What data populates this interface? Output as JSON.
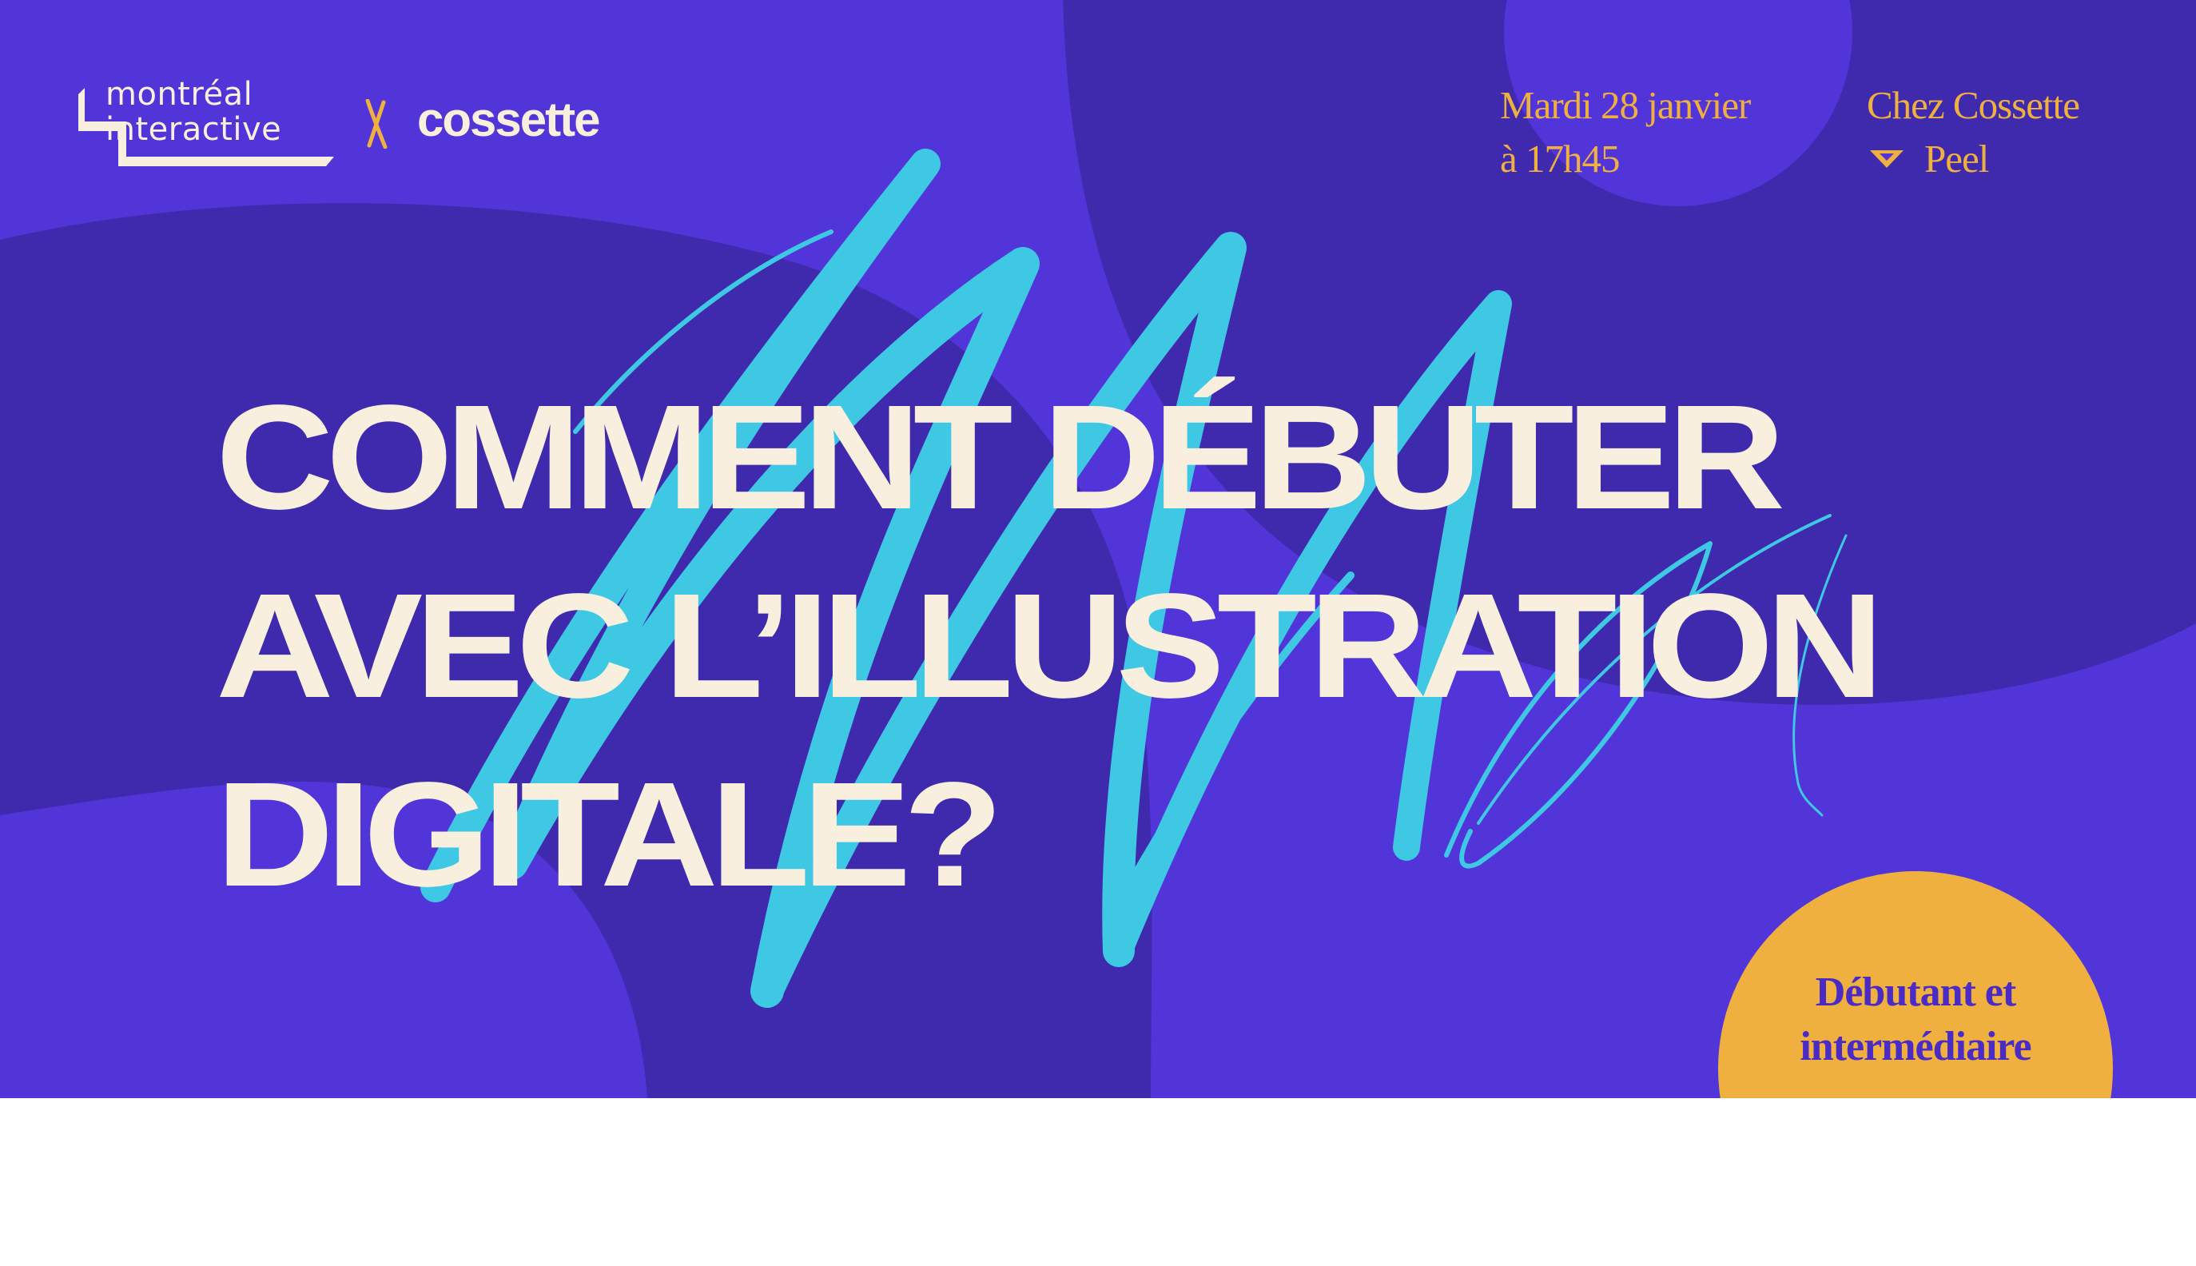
{
  "colors": {
    "background": "#5235d9",
    "dark_shape": "#3f2aae",
    "scribble": "#3ec8e4",
    "cream": "#f9efdf",
    "accent": "#efb040",
    "badge_text": "#4a2bc4"
  },
  "logos": {
    "montreal_interactive": {
      "line1": "montréal",
      "line2": "interactive"
    },
    "separator": "x",
    "partner": "cossette"
  },
  "event": {
    "date_line1": "Mardi 28 janvier",
    "date_line2": "à 17h45",
    "place_line1": "Chez Cossette",
    "place_line2": "Peel",
    "pin_icon": "location-triangle-icon"
  },
  "title": {
    "line1": "COMMENT DÉBUTER",
    "line2": "AVEC L’ILLUSTRATION",
    "line3": "DIGITALE?"
  },
  "badge": {
    "line1": "Débutant et",
    "line2": "intermédiaire"
  }
}
